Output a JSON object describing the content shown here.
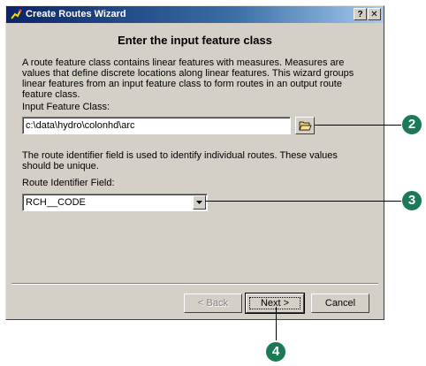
{
  "window": {
    "title": "Create Routes Wizard",
    "help_label": "?",
    "close_label": "✕",
    "icon": "route-wizard-icon"
  },
  "page": {
    "heading": "Enter the input feature class",
    "description": "A route feature class contains linear features with measures.  Measures are values that define discrete locations along linear features.  This wizard groups linear features from an input feature class to form routes in an output route feature class."
  },
  "input_feature_class": {
    "label": "Input Feature Class:",
    "value": "c:\\data\\hydro\\colonhd\\arc",
    "browse_icon": "open-folder-icon"
  },
  "route_identifier": {
    "description": "The route identifier field is used to identify individual routes.  These values should be unique.",
    "label": "Route Identifier Field:",
    "value": "RCH__CODE"
  },
  "buttons": {
    "back": "< Back",
    "next": "Next >",
    "cancel": "Cancel"
  },
  "callouts": {
    "browse_step": "2",
    "field_step": "3",
    "next_step": "4"
  },
  "colors": {
    "callout": "#1a7a56",
    "title_start": "#0a246a",
    "title_end": "#a6caf0"
  }
}
